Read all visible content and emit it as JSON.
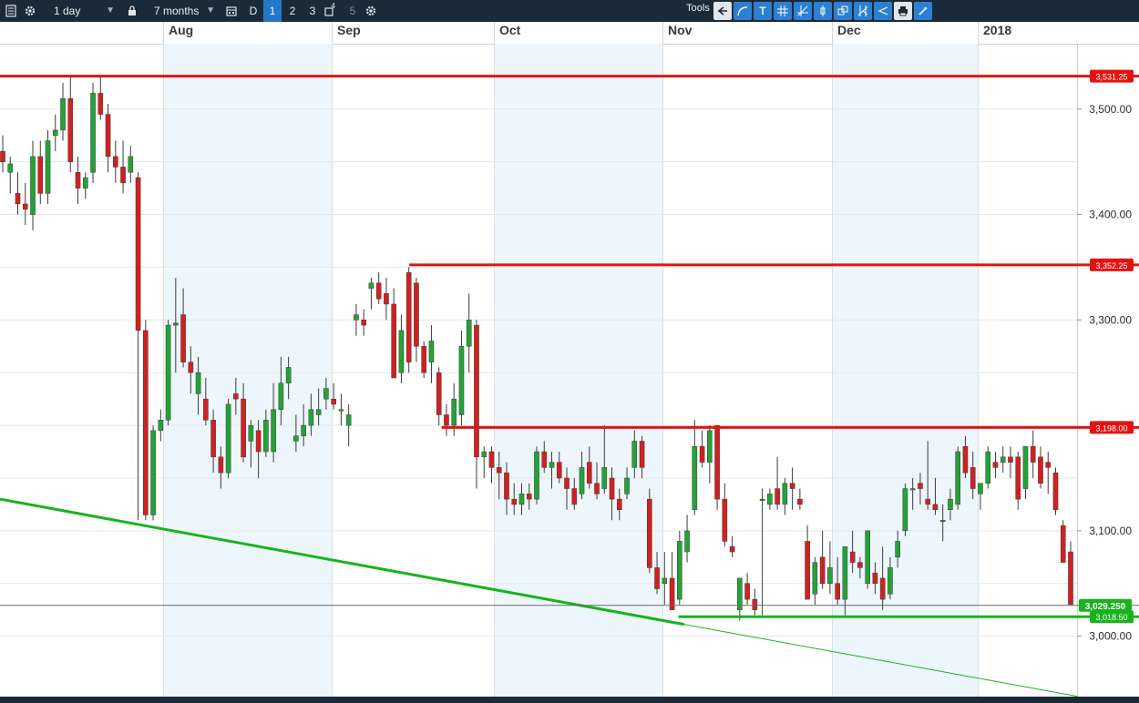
{
  "toolbar": {
    "interval_label": "1 day",
    "range_label": "7 months",
    "layout_d_label": "D",
    "layout_numbers": [
      "1",
      "2",
      "3",
      "5"
    ],
    "layout_superscript": "4",
    "tools_label": "Tools",
    "icons": [
      "list-icon",
      "gear-icon",
      "lock-icon",
      "calendar-icon",
      "settings-icon",
      "tools-back-icon",
      "draw-curve-icon",
      "text-tool-icon",
      "crosshair-icon",
      "trend-tool-icon",
      "marker-tool-icon",
      "layers-icon",
      "fork-icon",
      "channel-icon",
      "print-icon",
      "edit-icon"
    ]
  },
  "chart_data": {
    "type": "candlestick",
    "x_ticks": [
      "Aug",
      "Sep",
      "Oct",
      "Nov",
      "Dec",
      "2018"
    ],
    "y_ticks": [
      "3,500.00",
      "3,400.00",
      "3,300.00",
      "3,100.00",
      "3,000.00"
    ],
    "ylim": [
      2947,
      3562
    ],
    "grid": true,
    "colors": {
      "up": "#23a336",
      "down": "#d22020",
      "resistance": "#e41313",
      "support": "#19b31c",
      "shade": "#eef6fd"
    },
    "levels": [
      {
        "label": "3,531.25",
        "value": 3531.25,
        "kind": "resistance",
        "from": 0
      },
      {
        "label": "3,352.25",
        "value": 3352.25,
        "kind": "resistance",
        "from": 0.38
      },
      {
        "label": "3,198.00",
        "value": 3198.0,
        "kind": "resistance",
        "from": 0.41
      },
      {
        "label": "3,018.50",
        "value": 3018.5,
        "kind": "support",
        "from": 0.63
      }
    ],
    "last_price": {
      "label": "3,029.250",
      "value": 3029.25
    },
    "trendline": {
      "start": 3130,
      "end": 2943
    },
    "candles": [
      [
        3460,
        3475,
        3440,
        3450
      ],
      [
        3440,
        3455,
        3420,
        3448
      ],
      [
        3420,
        3440,
        3400,
        3410
      ],
      [
        3410,
        3430,
        3390,
        3405
      ],
      [
        3400,
        3470,
        3385,
        3455
      ],
      [
        3455,
        3470,
        3410,
        3420
      ],
      [
        3420,
        3480,
        3410,
        3470
      ],
      [
        3475,
        3495,
        3460,
        3480
      ],
      [
        3480,
        3525,
        3470,
        3510
      ],
      [
        3510,
        3530,
        3440,
        3450
      ],
      [
        3440,
        3455,
        3410,
        3425
      ],
      [
        3425,
        3440,
        3415,
        3435
      ],
      [
        3440,
        3525,
        3430,
        3515
      ],
      [
        3515,
        3530,
        3490,
        3495
      ],
      [
        3495,
        3505,
        3440,
        3455
      ],
      [
        3455,
        3470,
        3430,
        3445
      ],
      [
        3445,
        3470,
        3420,
        3430
      ],
      [
        3440,
        3465,
        3430,
        3455
      ],
      [
        3435,
        3440,
        3110,
        3290
      ],
      [
        3290,
        3300,
        3110,
        3115
      ],
      [
        3115,
        3200,
        3110,
        3195
      ],
      [
        3195,
        3215,
        3185,
        3205
      ],
      [
        3205,
        3300,
        3200,
        3295
      ],
      [
        3295,
        3340,
        3250,
        3297
      ],
      [
        3305,
        3330,
        3255,
        3260
      ],
      [
        3260,
        3275,
        3230,
        3250
      ],
      [
        3230,
        3265,
        3210,
        3250
      ],
      [
        3225,
        3245,
        3200,
        3205
      ],
      [
        3205,
        3215,
        3155,
        3170
      ],
      [
        3170,
        3180,
        3140,
        3155
      ],
      [
        3155,
        3225,
        3150,
        3220
      ],
      [
        3230,
        3245,
        3210,
        3225
      ],
      [
        3225,
        3240,
        3165,
        3170
      ],
      [
        3185,
        3205,
        3160,
        3200
      ],
      [
        3195,
        3205,
        3150,
        3175
      ],
      [
        3175,
        3215,
        3170,
        3205
      ],
      [
        3175,
        3240,
        3165,
        3215
      ],
      [
        3215,
        3265,
        3200,
        3240
      ],
      [
        3240,
        3265,
        3225,
        3255
      ],
      [
        3185,
        3210,
        3175,
        3190
      ],
      [
        3190,
        3220,
        3180,
        3200
      ],
      [
        3200,
        3230,
        3190,
        3215
      ],
      [
        3210,
        3235,
        3200,
        3215
      ],
      [
        3225,
        3245,
        3215,
        3235
      ],
      [
        3225,
        3240,
        3215,
        3220
      ],
      [
        3215,
        3230,
        3200,
        3215
      ],
      [
        3200,
        3220,
        3180,
        3210
      ],
      [
        3300,
        3315,
        3285,
        3305
      ],
      [
        3300,
        3310,
        3285,
        3295
      ],
      [
        3330,
        3340,
        3310,
        3335
      ],
      [
        3335,
        3345,
        3315,
        3320
      ],
      [
        3325,
        3340,
        3300,
        3315
      ],
      [
        3315,
        3330,
        3245,
        3245
      ],
      [
        3250,
        3305,
        3240,
        3290
      ],
      [
        3345,
        3350,
        3250,
        3260
      ],
      [
        3335,
        3340,
        3260,
        3275
      ],
      [
        3275,
        3280,
        3245,
        3250
      ],
      [
        3260,
        3295,
        3240,
        3280
      ],
      [
        3250,
        3255,
        3200,
        3210
      ],
      [
        3210,
        3220,
        3190,
        3200
      ],
      [
        3200,
        3240,
        3190,
        3225
      ],
      [
        3210,
        3290,
        3200,
        3275
      ],
      [
        3275,
        3325,
        3250,
        3300
      ],
      [
        3295,
        3300,
        3140,
        3170
      ],
      [
        3170,
        3180,
        3150,
        3175
      ],
      [
        3175,
        3180,
        3145,
        3160
      ],
      [
        3160,
        3175,
        3130,
        3155
      ],
      [
        3155,
        3165,
        3115,
        3130
      ],
      [
        3130,
        3145,
        3115,
        3125
      ],
      [
        3125,
        3145,
        3115,
        3135
      ],
      [
        3135,
        3145,
        3120,
        3130
      ],
      [
        3130,
        3180,
        3125,
        3175
      ],
      [
        3175,
        3185,
        3155,
        3160
      ],
      [
        3160,
        3175,
        3140,
        3165
      ],
      [
        3165,
        3175,
        3145,
        3150
      ],
      [
        3150,
        3160,
        3120,
        3140
      ],
      [
        3140,
        3150,
        3120,
        3125
      ],
      [
        3135,
        3175,
        3130,
        3160
      ],
      [
        3165,
        3180,
        3140,
        3145
      ],
      [
        3145,
        3165,
        3130,
        3135
      ],
      [
        3140,
        3200,
        3135,
        3160
      ],
      [
        3150,
        3160,
        3110,
        3130
      ],
      [
        3130,
        3140,
        3110,
        3120
      ],
      [
        3135,
        3160,
        3130,
        3150
      ],
      [
        3160,
        3195,
        3150,
        3185
      ],
      [
        3185,
        3190,
        3150,
        3160
      ],
      [
        3130,
        3140,
        3060,
        3065
      ],
      [
        3065,
        3080,
        3040,
        3045
      ],
      [
        3050,
        3080,
        3030,
        3055
      ],
      [
        3055,
        3080,
        3025,
        3025
      ],
      [
        3035,
        3100,
        3030,
        3090
      ],
      [
        3080,
        3115,
        3070,
        3100
      ],
      [
        3120,
        3205,
        3115,
        3180
      ],
      [
        3180,
        3195,
        3160,
        3165
      ],
      [
        3165,
        3200,
        3145,
        3195
      ],
      [
        3200,
        3200,
        3120,
        3130
      ],
      [
        3130,
        3145,
        3085,
        3090
      ],
      [
        3085,
        3095,
        3075,
        3080
      ],
      [
        3025,
        3055,
        3015,
        3055
      ],
      [
        3050,
        3060,
        3030,
        3035
      ],
      [
        3035,
        3045,
        3020,
        3025
      ],
      [
        3130,
        3140,
        3020,
        3130
      ],
      [
        3125,
        3140,
        3120,
        3135
      ],
      [
        3140,
        3170,
        3120,
        3125
      ],
      [
        3125,
        3150,
        3115,
        3145
      ],
      [
        3145,
        3160,
        3120,
        3140
      ],
      [
        3130,
        3140,
        3120,
        3125
      ],
      [
        3090,
        3105,
        3035,
        3035
      ],
      [
        3040,
        3075,
        3030,
        3070
      ],
      [
        3075,
        3100,
        3045,
        3050
      ],
      [
        3050,
        3090,
        3040,
        3065
      ],
      [
        3050,
        3075,
        3030,
        3035
      ],
      [
        3035,
        3085,
        3020,
        3085
      ],
      [
        3080,
        3100,
        3060,
        3070
      ],
      [
        3070,
        3075,
        3055,
        3065
      ],
      [
        3050,
        3100,
        3045,
        3100
      ],
      [
        3060,
        3070,
        3040,
        3050
      ],
      [
        3055,
        3085,
        3025,
        3035
      ],
      [
        3040,
        3075,
        3035,
        3065
      ],
      [
        3075,
        3100,
        3065,
        3090
      ],
      [
        3100,
        3145,
        3095,
        3140
      ],
      [
        3140,
        3150,
        3120,
        3140
      ],
      [
        3145,
        3155,
        3125,
        3140
      ],
      [
        3130,
        3185,
        3120,
        3125
      ],
      [
        3125,
        3150,
        3115,
        3120
      ],
      [
        3110,
        3125,
        3090,
        3110
      ],
      [
        3120,
        3140,
        3110,
        3130
      ],
      [
        3125,
        3180,
        3120,
        3175
      ],
      [
        3180,
        3190,
        3150,
        3155
      ],
      [
        3160,
        3175,
        3130,
        3140
      ],
      [
        3135,
        3145,
        3120,
        3145
      ],
      [
        3145,
        3180,
        3140,
        3175
      ],
      [
        3165,
        3175,
        3150,
        3160
      ],
      [
        3165,
        3180,
        3155,
        3170
      ],
      [
        3170,
        3180,
        3150,
        3165
      ],
      [
        3170,
        3175,
        3120,
        3130
      ],
      [
        3140,
        3180,
        3130,
        3180
      ],
      [
        3180,
        3195,
        3150,
        3165
      ],
      [
        3170,
        3180,
        3140,
        3145
      ],
      [
        3165,
        3175,
        3135,
        3160
      ],
      [
        3155,
        3160,
        3115,
        3120
      ],
      [
        3105,
        3110,
        3070,
        3070
      ],
      [
        3080,
        3090,
        3030,
        3030
      ]
    ]
  }
}
